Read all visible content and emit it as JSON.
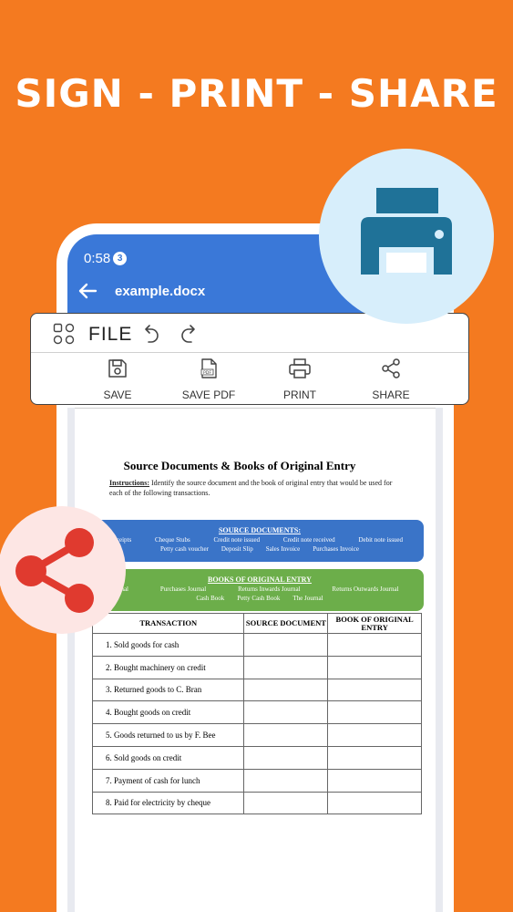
{
  "headline": "SIGN - PRINT - SHARE",
  "status": {
    "time": "0:58",
    "notification_count": "3"
  },
  "appbar": {
    "title": "example.docx"
  },
  "toolbar": {
    "menu_label": "FILE",
    "buttons": [
      {
        "label": "SAVE",
        "icon": "save-icon"
      },
      {
        "label": "SAVE PDF",
        "icon": "pdf-icon"
      },
      {
        "label": "PRINT",
        "icon": "printer-icon"
      },
      {
        "label": "SHARE",
        "icon": "share-icon"
      }
    ]
  },
  "document": {
    "heading": "Source Documents & Books of Original Entry",
    "instructions_label": "Instructions:",
    "instructions_text": " Identify the source document and the book of original entry that would be used for each of the following transactions.",
    "source_box": {
      "title": "SOURCE DOCUMENTS:",
      "row1": [
        "ceipts",
        "Cheque Stubs",
        "Credit note issued",
        "Credit note received",
        "Debit note issued"
      ],
      "row2": [
        "Petty cash voucher",
        "Deposit Slip",
        "Sales Invoice",
        "Purchases Invoice"
      ]
    },
    "books_box": {
      "title": "BOOKS OF ORIGINAL ENTRY",
      "row1": [
        "nal",
        "Purchases Journal",
        "Returns Inwards Journal",
        "Returns Outwards Journal"
      ],
      "row2": [
        "Cash Book",
        "Petty Cash Book",
        "The Journal"
      ]
    },
    "table": {
      "headers": [
        "TRANSACTION",
        "SOURCE DOCUMENT",
        "BOOK OF ORIGINAL ENTRY"
      ],
      "rows": [
        "1. Sold goods for cash",
        "2. Bought machinery on credit",
        "3. Returned goods to C. Bran",
        "4. Bought goods on credit",
        "5. Goods returned to us by F. Bee",
        "6. Sold goods on credit",
        "7. Payment of cash for lunch",
        "8. Paid for electricity by cheque"
      ]
    }
  },
  "colors": {
    "background": "#f47a20",
    "appbar": "#3a78d8",
    "print_bubble": "#d7eefb",
    "printer_icon": "#1f7298",
    "share_bubble": "#fde6e4",
    "share_icon": "#e03a2f",
    "source_box": "#3a74c8",
    "books_box": "#6cae4a"
  }
}
